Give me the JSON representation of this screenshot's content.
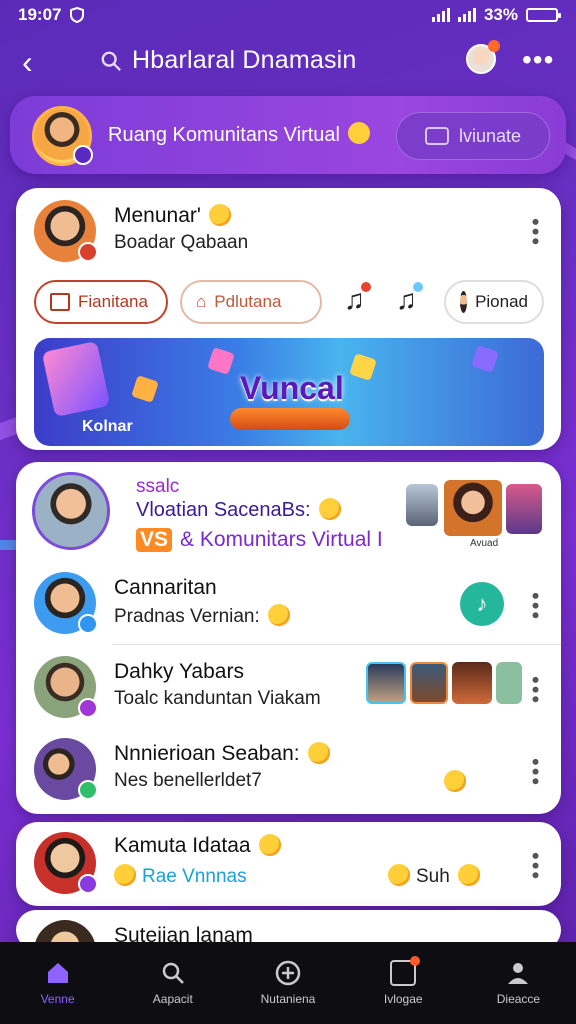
{
  "status": {
    "time": "19:07",
    "battery": "33%",
    "battery_level": 0.33
  },
  "header": {
    "title": "Hbarlaral Dnamasin",
    "back_icon": "chevron-left-icon",
    "search_icon": "search-icon",
    "menu_icon": "more-horizontal-icon"
  },
  "community": {
    "title": "Ruang Komunitans Virtual",
    "button_label": "lviunate"
  },
  "post": {
    "name": "Menunar'",
    "subtitle": "Boadar Qabaan",
    "chips": [
      "Fianitana",
      "Pdlutana",
      "Pionad"
    ],
    "banner_title": "Vuncal",
    "banner_label": "Kolnar"
  },
  "event": {
    "tag": "ssalc",
    "line1": "Vloatian SacenaBs:",
    "vs": "VS",
    "line2": "& Komunitars Virtual I",
    "thumb_caption": "Avuad"
  },
  "members": [
    {
      "name": "Cannaritan",
      "subtitle": "Pradnas Vernian:"
    },
    {
      "name": "Dahky Yabars",
      "subtitle": "Toalc kanduntan Viakam"
    },
    {
      "name": "Nnnierioan Seaban:",
      "subtitle": "Nes benellerldet7"
    }
  ],
  "card3": {
    "name": "Kamuta Idataa",
    "subtitle": "Rae Vnnnas",
    "suffix": "Suh"
  },
  "card4": {
    "name": "Sutejian lanam"
  },
  "tabs": [
    {
      "label": "Venne",
      "icon": "home-icon",
      "active": true
    },
    {
      "label": "Aapacit",
      "icon": "search-icon",
      "active": false
    },
    {
      "label": "Nutaniena",
      "icon": "add-circle-icon",
      "active": false
    },
    {
      "label": "Ivlogae",
      "icon": "messages-icon",
      "active": false
    },
    {
      "label": "Dieacce",
      "icon": "profile-icon",
      "active": false
    }
  ],
  "colors": {
    "accent": "#8f63ff",
    "teal": "#25b79c",
    "orange": "#ff8a22",
    "background": "#6a2fc4"
  }
}
